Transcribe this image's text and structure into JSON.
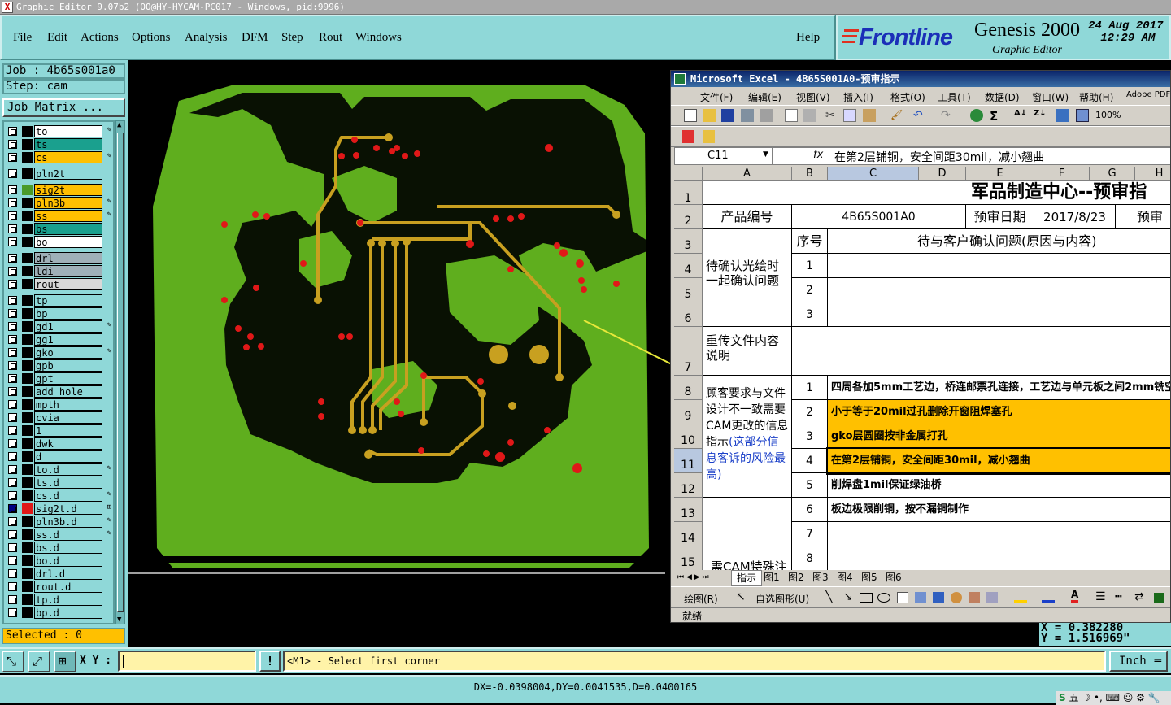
{
  "window": {
    "title": "Graphic Editor 9.07b2 (OO@HY-HYCAM-PC017 - Windows, pid:9996)"
  },
  "menu": [
    "File",
    "Edit",
    "Actions",
    "Options",
    "Analysis",
    "DFM",
    "Step",
    "Rout",
    "Windows"
  ],
  "help_label": "Help",
  "brand": {
    "logo": "Frontline",
    "product": "Genesis 2000",
    "subtitle": "Graphic Editor",
    "date": "24 Aug 2017",
    "time": "12:29 AM"
  },
  "job": {
    "job_label": "Job : 4b65s001a0",
    "step_label": "Step: cam",
    "matrix_button": "Job Matrix ..."
  },
  "layers": [
    {
      "name": "to",
      "color": "#ffffff",
      "icon": "✎"
    },
    {
      "name": "ts",
      "color": "#1aa08e",
      "icon": ""
    },
    {
      "name": "cs",
      "color": "#ffc000",
      "icon": "✎"
    },
    {
      "name": "pln2t",
      "color": "#8fd8d8",
      "icon": "",
      "gap": true
    },
    {
      "name": "sig2t",
      "color": "#ffc000",
      "icon": "",
      "gap": true,
      "swatch": "#4a9a2a"
    },
    {
      "name": "pln3b",
      "color": "#ffc000",
      "icon": "✎"
    },
    {
      "name": "ss",
      "color": "#ffc000",
      "icon": "✎"
    },
    {
      "name": "bs",
      "color": "#1aa08e",
      "icon": ""
    },
    {
      "name": "bo",
      "color": "#ffffff",
      "icon": ""
    },
    {
      "name": "drl",
      "color": "#9fb0b8",
      "icon": "",
      "gap": true
    },
    {
      "name": "ldi",
      "color": "#9fb0b8",
      "icon": ""
    },
    {
      "name": "rout",
      "color": "#d8d8d8",
      "icon": ""
    },
    {
      "name": "tp",
      "color": "#8fd8d8",
      "icon": "",
      "gap": true
    },
    {
      "name": "bp",
      "color": "#8fd8d8",
      "icon": ""
    },
    {
      "name": "gd1",
      "color": "#8fd8d8",
      "icon": "✎"
    },
    {
      "name": "gg1",
      "color": "#8fd8d8",
      "icon": ""
    },
    {
      "name": "gko",
      "color": "#8fd8d8",
      "icon": "✎"
    },
    {
      "name": "gpb",
      "color": "#8fd8d8",
      "icon": ""
    },
    {
      "name": "gpt",
      "color": "#8fd8d8",
      "icon": ""
    },
    {
      "name": "add_hole",
      "color": "#8fd8d8",
      "icon": ""
    },
    {
      "name": "mpth",
      "color": "#8fd8d8",
      "icon": ""
    },
    {
      "name": "cvia",
      "color": "#8fd8d8",
      "icon": ""
    },
    {
      "name": "1",
      "color": "#8fd8d8",
      "icon": ""
    },
    {
      "name": "dwk",
      "color": "#8fd8d8",
      "icon": ""
    },
    {
      "name": "d",
      "color": "#8fd8d8",
      "icon": ""
    },
    {
      "name": "to.d",
      "color": "#8fd8d8",
      "icon": "✎"
    },
    {
      "name": "ts.d",
      "color": "#8fd8d8",
      "icon": ""
    },
    {
      "name": "cs.d",
      "color": "#8fd8d8",
      "icon": "✎"
    },
    {
      "name": "sig2t.d",
      "color": "#8fd8d8",
      "icon": "⊞",
      "active": true
    },
    {
      "name": "pln3b.d",
      "color": "#8fd8d8",
      "icon": "✎"
    },
    {
      "name": "ss.d",
      "color": "#8fd8d8",
      "icon": "✎"
    },
    {
      "name": "bs.d",
      "color": "#8fd8d8",
      "icon": ""
    },
    {
      "name": "bo.d",
      "color": "#8fd8d8",
      "icon": ""
    },
    {
      "name": "drl.d",
      "color": "#8fd8d8",
      "icon": ""
    },
    {
      "name": "rout.d",
      "color": "#8fd8d8",
      "icon": ""
    },
    {
      "name": "tp.d",
      "color": "#8fd8d8",
      "icon": ""
    },
    {
      "name": "bp.d",
      "color": "#8fd8d8",
      "icon": ""
    }
  ],
  "selected_label": "Selected : 0",
  "excel": {
    "title": "Microsoft Excel - 4B65S001A0-预审指示",
    "menu": [
      "文件(F)",
      "编辑(E)",
      "视图(V)",
      "插入(I)",
      "格式(O)",
      "工具(T)",
      "数据(D)",
      "窗口(W)",
      "帮助(H)",
      "Adobe PDF"
    ],
    "zoom": "100%",
    "name_box": "C11",
    "fx": "fx",
    "formula": "在第2层铺铜，安全间距30mil，减小翘曲",
    "columns": [
      "A",
      "B",
      "C",
      "D",
      "E",
      "F",
      "G",
      "H"
    ],
    "rows": [
      "1",
      "2",
      "3",
      "4",
      "5",
      "6",
      "7",
      "8",
      "9",
      "10",
      "11",
      "12",
      "13",
      "14",
      "15"
    ],
    "title_cell": "军品制造中心--预审指",
    "product_no_label": "产品编号",
    "product_no": "4B65S001A0",
    "review_date_label": "预审日期",
    "review_date": "2017/8/23",
    "reviewer_label": "预审",
    "seq_label": "序号",
    "issue_header": "待与客户确认问题(原因与内容)",
    "group1": "待确认光绘时一起确认问题",
    "group2": "重传文件内容说明",
    "group3_black": "顾客要求与文件设计不一致需要CAM更改的信息指示",
    "group3_blue": "(这部分信息客诉的风险最高)",
    "group4": "需CAM特殊注",
    "seq1": [
      "1",
      "2",
      "3"
    ],
    "items": [
      {
        "n": "1",
        "text": "四周各加5mm工艺边，桥连邮票孔连接，工艺边与单元板之间2mm铣空",
        "hl": false
      },
      {
        "n": "2",
        "text": "小于等于20mil过孔删除开窗阻焊塞孔",
        "hl": true
      },
      {
        "n": "3",
        "text": "gko层圆圈按非金属打孔",
        "hl": true
      },
      {
        "n": "4",
        "text": "在第2层铺铜，安全间距30mil，减小翘曲",
        "hl": true
      },
      {
        "n": "5",
        "text": "削焊盘1mil保证绿油桥",
        "hl": false
      },
      {
        "n": "6",
        "text": "板边极限削铜，按不漏铜制作",
        "hl": false
      },
      {
        "n": "7",
        "text": "",
        "hl": false
      },
      {
        "n": "8",
        "text": "",
        "hl": false
      }
    ],
    "tabs": [
      "指示",
      "图1",
      "图2",
      "图3",
      "图4",
      "图5",
      "图6"
    ],
    "draw_label": "绘图(R)",
    "autoshape_label": "自选图形(U)",
    "status": "就绪"
  },
  "coords": {
    "x_label": "X = 0.382280",
    "y_label": "Y = 1.516969\""
  },
  "command": {
    "xy_label": "X Y :",
    "xy_value": "",
    "bang": "!",
    "prompt": "<M1> - Select first corner",
    "unit": "Inch"
  },
  "status_line": "DX=-0.0398004,DY=0.0041535,D=0.0400165",
  "tray": "五"
}
